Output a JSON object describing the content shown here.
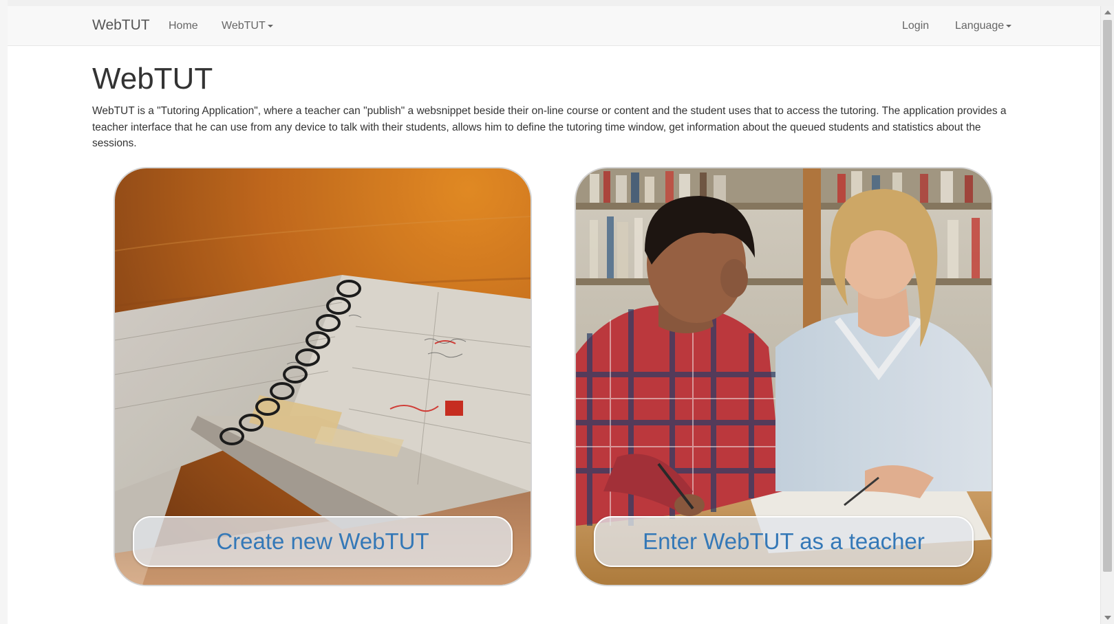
{
  "navbar": {
    "brand": "WebTUT",
    "items": [
      {
        "label": "Home"
      },
      {
        "label": "WebTUT",
        "dropdown": true
      }
    ],
    "right_items": [
      {
        "label": "Login"
      },
      {
        "label": "Language",
        "dropdown": true
      }
    ]
  },
  "main": {
    "title": "WebTUT",
    "description": "WebTUT is a \"Tutoring Application\", where a teacher can \"publish\" a websnippet beside their on-line course or content and the student uses that to access the tutoring. The application provides a teacher interface that he can use from any device to talk with their students, allows him to define the tutoring time window, get information about the queued students and statistics about the sessions.",
    "cards": [
      {
        "button_label": "Create new WebTUT",
        "image": "planner-notebook-photo"
      },
      {
        "button_label": "Enter WebTUT as a teacher",
        "image": "teacher-student-photo"
      }
    ]
  },
  "colors": {
    "link": "#3478b7",
    "navbar_bg": "#f8f8f8",
    "text": "#333333"
  }
}
